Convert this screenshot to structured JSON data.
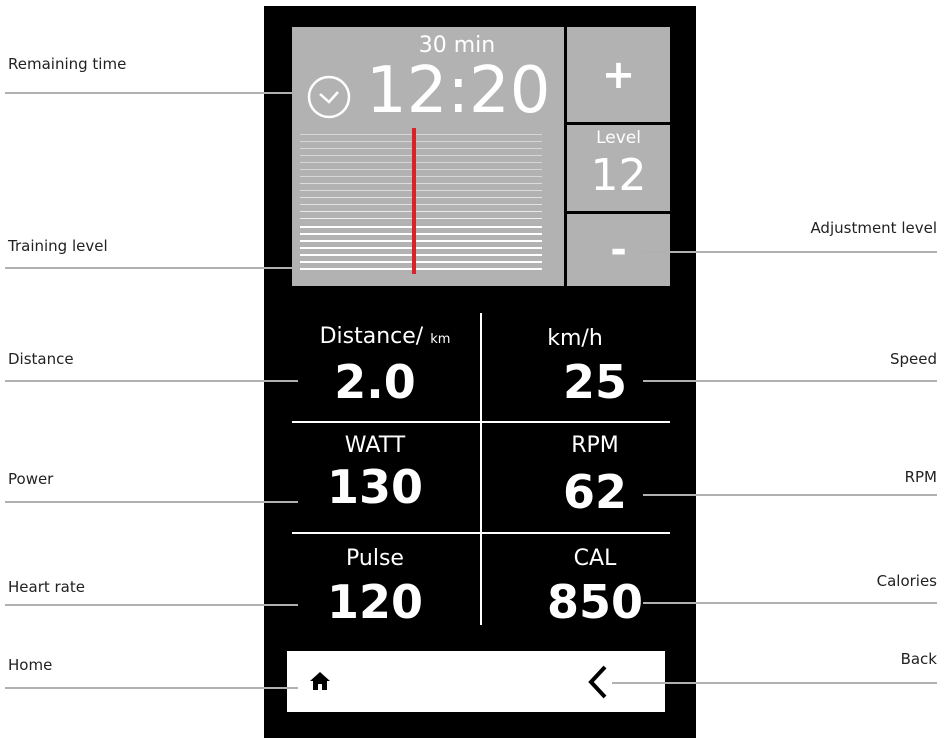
{
  "timer": {
    "duration": "30 min",
    "remaining": "12:20"
  },
  "level_control": {
    "plus_label": "+",
    "level_label": "Level",
    "level_value": "12",
    "minus_label": "-"
  },
  "metrics": [
    {
      "label": "Distance/",
      "unit": "km",
      "value": "2.0"
    },
    {
      "label": "km/h",
      "unit": "",
      "value": "25"
    },
    {
      "label": "WATT",
      "unit": "",
      "value": "130"
    },
    {
      "label": "RPM",
      "unit": "",
      "value": "62"
    },
    {
      "label": "Pulse",
      "unit": "",
      "value": "120"
    },
    {
      "label": "CAL",
      "unit": "",
      "value": "850"
    }
  ],
  "callouts": {
    "remaining_time": "Remaining time",
    "training_level": "Training level",
    "distance": "Distance",
    "power": "Power",
    "heart_rate": "Heart rate",
    "home": "Home",
    "adjustment_level": "Adjustment level",
    "speed": "Speed",
    "rpm": "RPM",
    "calories": "Calories",
    "back": "Back"
  },
  "icons": {
    "clock": "clock-icon",
    "home": "home-icon",
    "back": "chevron-left-icon"
  },
  "colors": {
    "panel_gray": "#b2b2b2",
    "screen_black": "#000000",
    "level_indicator_red": "#d9222a"
  }
}
